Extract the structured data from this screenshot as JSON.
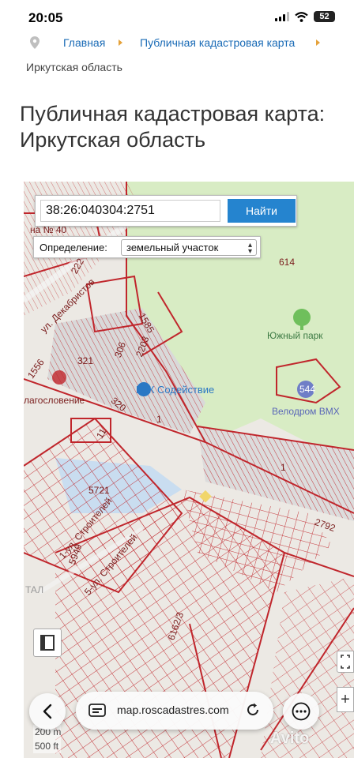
{
  "status_bar": {
    "time": "20:05",
    "battery": "52"
  },
  "breadcrumb": {
    "home": "Главная",
    "map": "Публичная кадастровая карта",
    "current": "Иркутская область"
  },
  "page_title": "Публичная кадастровая карта: Иркутская область",
  "map": {
    "search_value": "38:26:040304:2751",
    "search_button": "Найти",
    "definition_label": "Определение:",
    "definition_value": "земельный участок",
    "labels": {
      "n614": "614",
      "n1585": "1585",
      "n2203": "2203",
      "n306": "306",
      "n321": "321",
      "n1556": "1556",
      "n320": "320",
      "n1a": "1",
      "n11": "11",
      "n1b": "1",
      "n544": "544",
      "n5721": "5721",
      "n2792": "2792",
      "n5949": "5949",
      "n6162": "6162/3",
      "n40": "на № 40",
      "n222": "222",
      "street_dekabr": "ул. Декабристов",
      "street_stroit1": "1-ул. Строителей",
      "street_stroit2": "5-ул. Строителей",
      "blago": "лагословение",
      "tal": "ТАЛ"
    },
    "poi": {
      "park": "Южный парк",
      "gsk": "ГСК Содействие",
      "velodrom": "Велодром ВМХ"
    },
    "scale": {
      "meters": "200 m",
      "feet": "500 ft"
    }
  },
  "browser": {
    "url": "map.roscadastres.com"
  },
  "watermark": "Avito",
  "colors": {
    "accent": "#2584cf",
    "parcel_line": "#c0262c",
    "park_green": "#d8ecc4",
    "water": "#c9ddf0"
  }
}
